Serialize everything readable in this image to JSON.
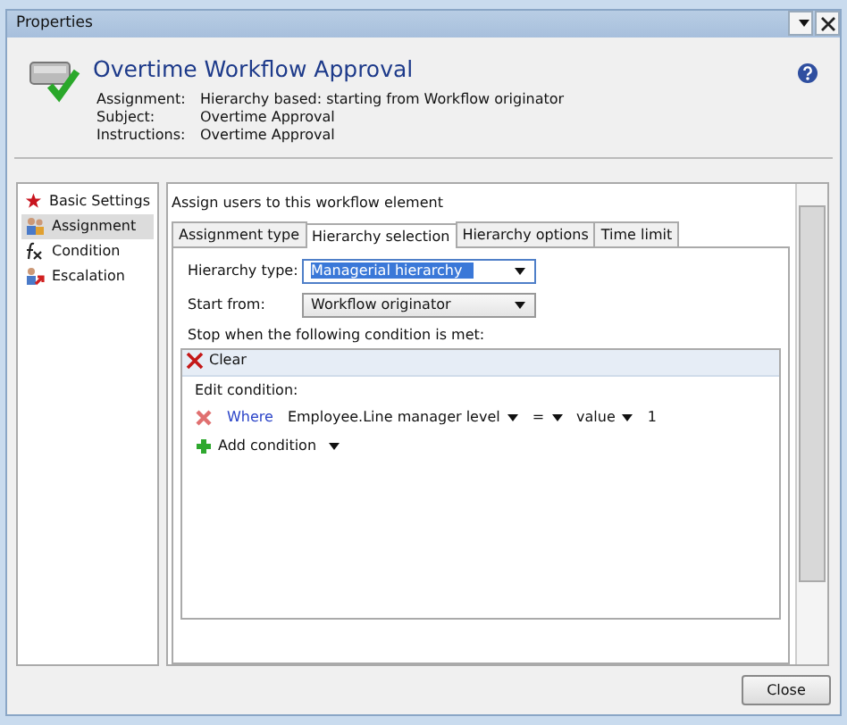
{
  "window": {
    "title": "Properties"
  },
  "header": {
    "title": "Overtime Workflow Approval",
    "details": [
      {
        "label": "Assignment:",
        "value": "Hierarchy based: starting from Workflow originator"
      },
      {
        "label": "Subject:",
        "value": "Overtime Approval"
      },
      {
        "label": "Instructions:",
        "value": "Overtime Approval"
      }
    ]
  },
  "sidebar": {
    "items": [
      {
        "label": "Basic Settings",
        "kind": "star",
        "selected": false
      },
      {
        "label": "Assignment",
        "kind": "users",
        "selected": true
      },
      {
        "label": "Condition",
        "kind": "formula",
        "selected": false
      },
      {
        "label": "Escalation",
        "kind": "escalation",
        "selected": false
      }
    ]
  },
  "panel": {
    "heading": "Assign users to this workflow element",
    "tabs": [
      {
        "label": "Assignment type",
        "selected": false
      },
      {
        "label": "Hierarchy selection",
        "selected": true
      },
      {
        "label": "Hierarchy options",
        "selected": false
      },
      {
        "label": "Time limit",
        "selected": false
      }
    ],
    "fields": [
      {
        "label": "Hierarchy type:",
        "value": "Managerial hierarchy",
        "focused": true
      },
      {
        "label": "Start from:",
        "value": "Workflow originator",
        "focused": false
      }
    ],
    "condition_heading": "Stop when the following condition is met:",
    "clear": "Clear",
    "edit_label": "Edit condition:",
    "condition": {
      "link": "Where",
      "field": "Employee.Line manager level",
      "operator": "=",
      "type": "value",
      "value": "1"
    },
    "add": "Add condition"
  },
  "buttons": [
    "Close"
  ]
}
